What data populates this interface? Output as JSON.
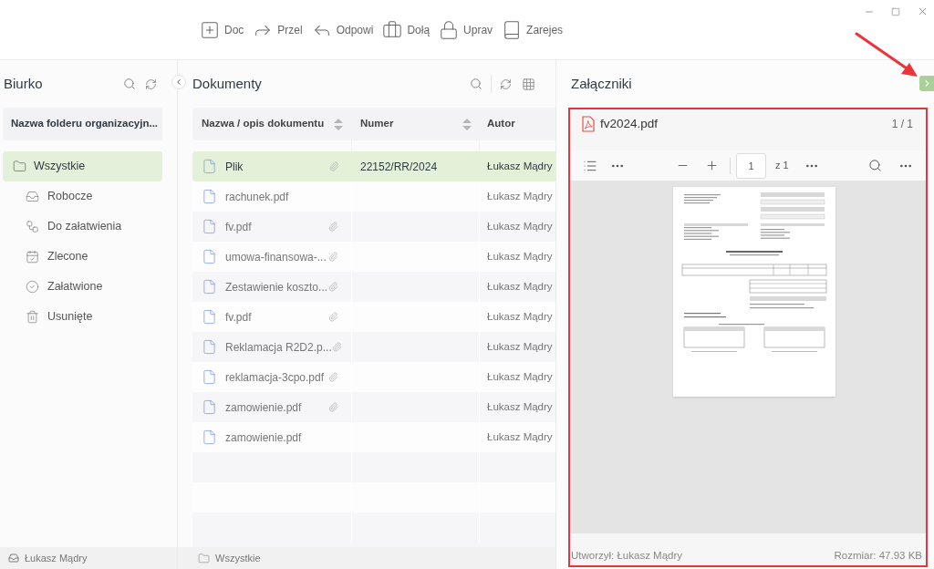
{
  "toolbar": [
    "Doc",
    "Przel",
    "Odpowi",
    "Dołą",
    "Uprav",
    "Zarejes"
  ],
  "sidebar": {
    "title": "Biurko",
    "folder": "Nazwa folderu organizacyjn...",
    "items": [
      {
        "label": "Wszystkie",
        "selected": true,
        "children": [
          {
            "label": "Robocze",
            "selected": false
          },
          {
            "label": "Do załatwienia",
            "selected": false
          },
          {
            "label": "Zlecone",
            "selected": false
          },
          {
            "label": "Załatwione",
            "selected": false
          },
          {
            "label": "Usunięte",
            "selected": false
          }
        ]
      }
    ],
    "status": "Łukasz Mądry"
  },
  "documents": {
    "title": "Dokumenty",
    "columns": [
      {
        "label": "Nazwa / opis dokumentu",
        "sortable": true
      },
      {
        "label": "Numer",
        "sortable": true
      },
      {
        "label": "Autor"
      }
    ],
    "rows": [
      {
        "name": "Plik",
        "attachment": true,
        "number": "22152/RR/2024",
        "author": "Łukasz Mądry",
        "selected": true
      },
      {
        "name": "rachunek.pdf",
        "attachment": false,
        "author": "Łukasz Mądry",
        "selected": false
      },
      {
        "name": "fv.pdf",
        "attachment": true,
        "author": "Łukasz Mądry",
        "selected": false
      },
      {
        "name": "umowa-finansowa-...",
        "attachment": true,
        "author": "Łukasz Mądry",
        "selected": false
      },
      {
        "name": "Zestawienie koszto...",
        "attachment": true,
        "author": "Łukasz Mądry",
        "selected": false
      },
      {
        "name": "fv.pdf",
        "attachment": true,
        "author": "Łukasz Mądry",
        "selected": false
      },
      {
        "name": "Reklamacja R2D2.p...",
        "attachment": true,
        "author": "Łukasz Mądry",
        "selected": false
      },
      {
        "name": "reklamacja-3cpo.pdf",
        "attachment": true,
        "author": "Łukasz Mądry",
        "selected": false
      },
      {
        "name": "zamowienie.pdf",
        "attachment": true,
        "author": "Łukasz Mądry",
        "selected": false
      },
      {
        "name": "zamowienie.pdf",
        "attachment": false,
        "author": "Łukasz Mądry",
        "selected": false
      }
    ],
    "status": "Wszystkie"
  },
  "attachments": {
    "title": "Załączniki",
    "file": {
      "name": "fv2024.pdf",
      "pages": "1 / 1"
    },
    "viewer": {
      "page": "1",
      "total": "z 1"
    },
    "created_by": "Utworzył: Łukasz Mądry",
    "size": "Rozmiar: 47.93 KB"
  }
}
